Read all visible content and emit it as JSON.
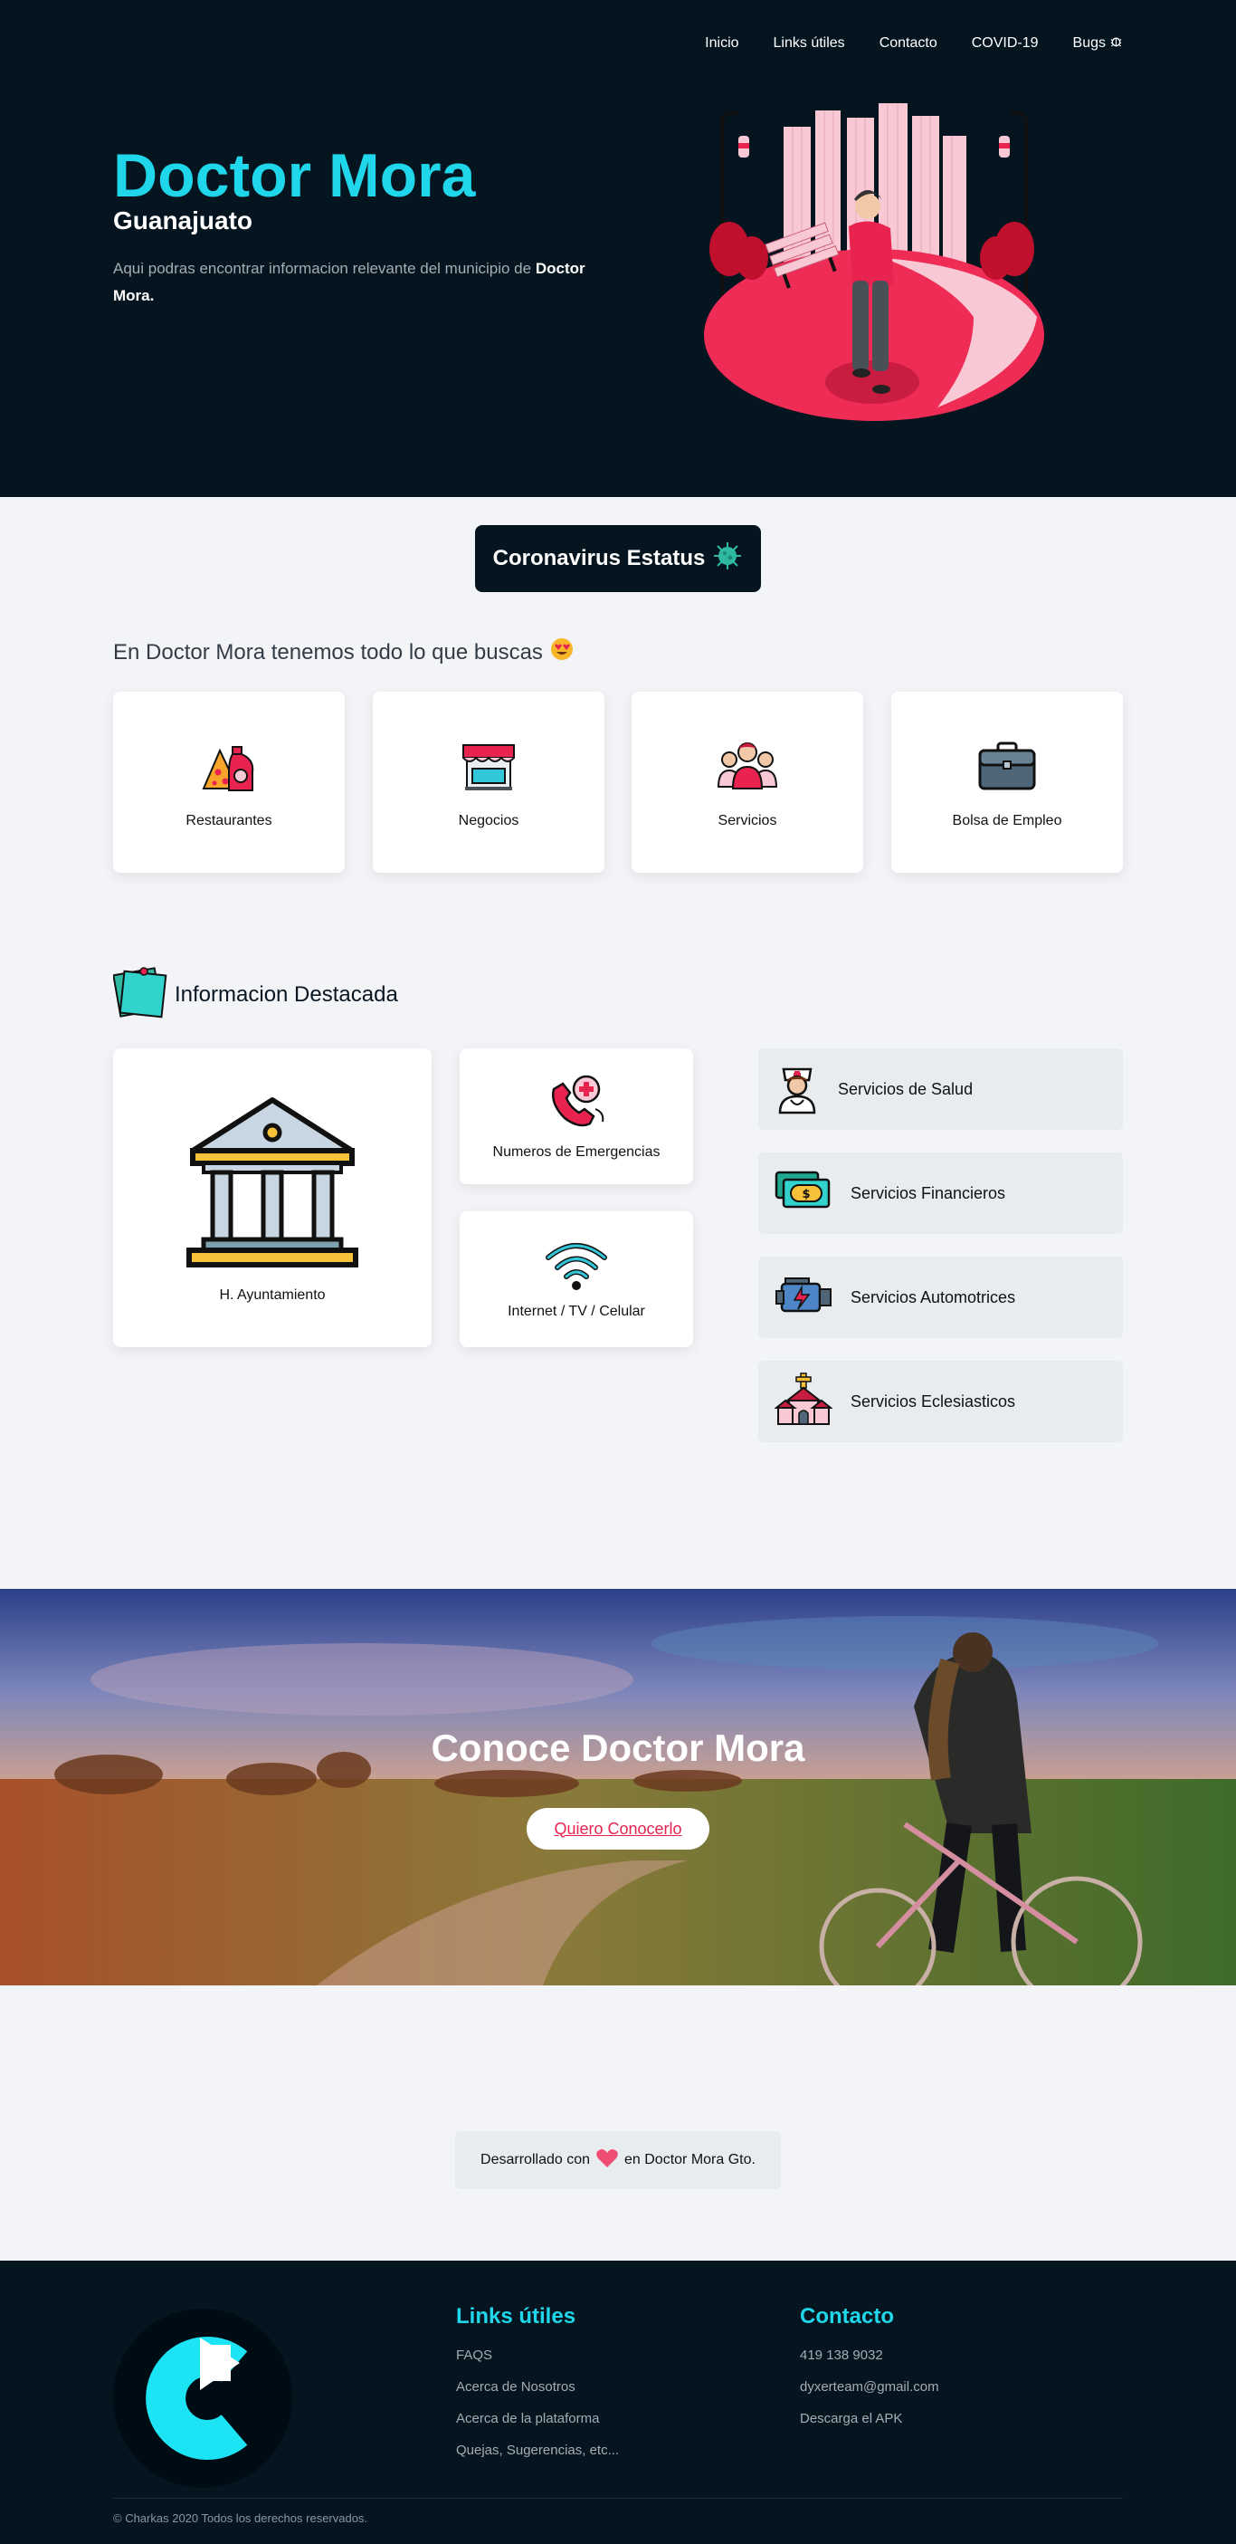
{
  "nav": {
    "items": [
      "Inicio",
      "Links útiles",
      "Contacto",
      "COVID-19",
      "Bugs"
    ]
  },
  "hero": {
    "title": "Doctor Mora",
    "subtitle": "Guanajuato",
    "description_prefix": "Aqui podras encontrar informacion relevante del municipio de ",
    "description_bold": "Doctor Mora."
  },
  "covid": {
    "label": "Coronavirus Estatus"
  },
  "tagline": "En Doctor Mora tenemos todo lo que buscas",
  "categories": [
    {
      "label": "Restaurantes",
      "icon": "pizza-drink-icon"
    },
    {
      "label": "Negocios",
      "icon": "store-icon"
    },
    {
      "label": "Servicios",
      "icon": "people-icon"
    },
    {
      "label": "Bolsa de Empleo",
      "icon": "briefcase-icon"
    }
  ],
  "featured": {
    "title": "Informacion Destacada",
    "cards": [
      {
        "label": "H. Ayuntamiento",
        "icon": "city-hall-icon"
      },
      {
        "label": "Numeros de Emergencias",
        "icon": "emergency-phone-icon"
      },
      {
        "label": "Internet / TV / Celular",
        "icon": "wifi-icon"
      }
    ],
    "services": [
      {
        "label": "Servicios de Salud",
        "icon": "nurse-icon"
      },
      {
        "label": "Servicios Financieros",
        "icon": "money-icon"
      },
      {
        "label": "Servicios Automotrices",
        "icon": "engine-icon"
      },
      {
        "label": "Servicios Eclesiasticos",
        "icon": "church-icon"
      }
    ]
  },
  "banner": {
    "title_prefix": "Conoce ",
    "title_bold": "Doctor Mora",
    "button": "Quiero Conocerlo"
  },
  "developed": {
    "prefix": "Desarrollado con",
    "suffix": "en Doctor Mora Gto."
  },
  "footer": {
    "links_title": "Links útiles",
    "links": [
      "FAQS",
      "Acerca de Nosotros",
      "Acerca de la plataforma",
      "Quejas, Sugerencias, etc..."
    ],
    "contact_title": "Contacto",
    "contact": [
      "419 138 9032",
      "dyxerteam@gmail.com",
      "Descarga el APK"
    ],
    "copyright": "© Charkas 2020 Todos los derechos reservados."
  },
  "colors": {
    "accent": "#1fd6ea",
    "dark": "#051520",
    "pink": "#e8234f"
  }
}
